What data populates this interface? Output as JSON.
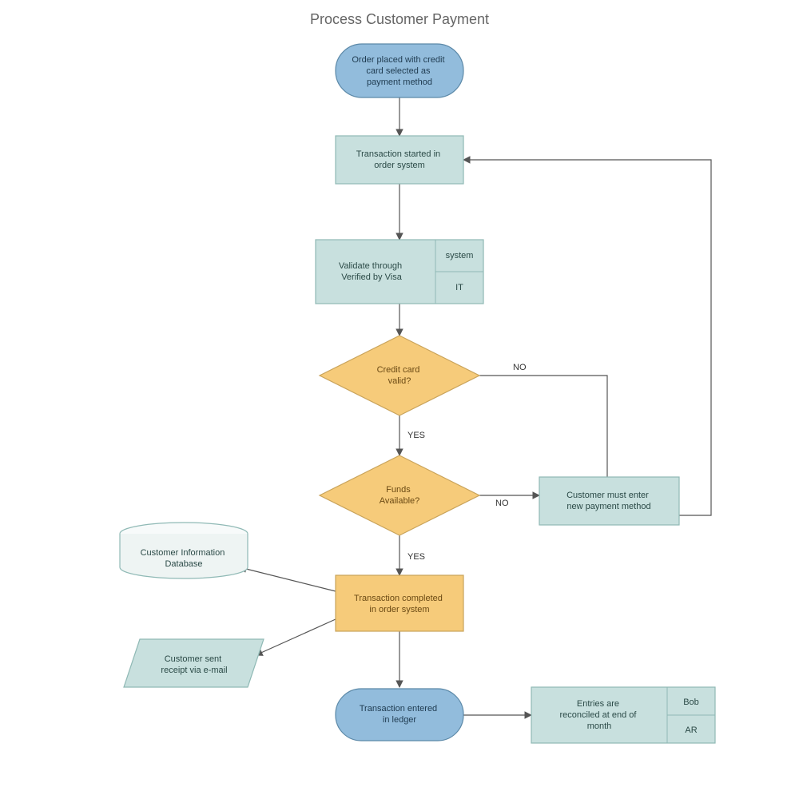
{
  "title": "Process Customer Payment",
  "nodes": {
    "start": {
      "label": "Order placed with credit card selected as payment method"
    },
    "txn_start": {
      "label": "Transaction started in order system"
    },
    "validate": {
      "label": "Validate through Verified by Visa",
      "tag1": "system",
      "tag2": "IT"
    },
    "cc_valid": {
      "label": "Credit card valid?"
    },
    "funds": {
      "label": "Funds Available?"
    },
    "new_pay": {
      "label": "Customer must enter new payment method"
    },
    "txn_done": {
      "label": "Transaction completed in order system"
    },
    "db": {
      "label": "Customer Information Database"
    },
    "receipt": {
      "label": "Customer sent receipt via e-mail"
    },
    "ledger": {
      "label": "Transaction entered in ledger"
    },
    "reconcile": {
      "label": "Entries are reconciled at end of month",
      "tag1": "Bob",
      "tag2": "AR"
    }
  },
  "labels": {
    "yes": "YES",
    "no": "NO"
  },
  "colors": {
    "terminator_fill": "#92bcdc",
    "terminator_stroke": "#5c89a8",
    "process_teal_fill": "#c8e0de",
    "process_teal_stroke": "#8fb9b5",
    "decision_fill": "#f6cb7a",
    "decision_stroke": "#c9a35a",
    "subprocess_fill": "#f6cb7a",
    "subprocess_stroke": "#c9a35a",
    "arrow": "#555555",
    "text": "#333333",
    "title": "#656565"
  }
}
